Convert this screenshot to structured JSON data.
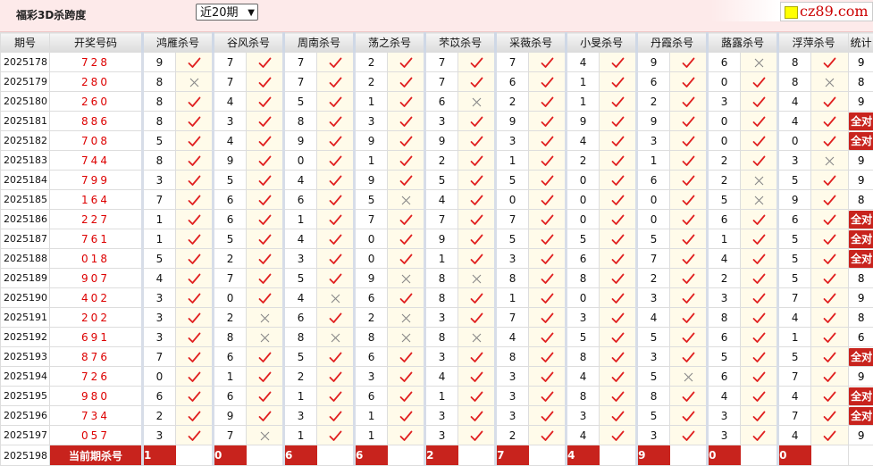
{
  "header": {
    "title": "福彩3D杀跨度",
    "period_select": "近20期",
    "logo_text": "cz89.com"
  },
  "columns": {
    "period": "期号",
    "draw": "开奖号码",
    "experts": [
      "鸿雁杀号",
      "谷风杀号",
      "周南杀号",
      "荡之杀号",
      "芣苡杀号",
      "采薇杀号",
      "小旻杀号",
      "丹霞杀号",
      "蕗露杀号",
      "浮萍杀号"
    ],
    "stat": "统计"
  },
  "colors": {
    "accent": "#c8231d",
    "check": "#e02020",
    "cross": "#888888"
  },
  "rows": [
    {
      "period": "2025178",
      "draw": "728",
      "p": [
        [
          9,
          1
        ],
        [
          7,
          1
        ],
        [
          7,
          1
        ],
        [
          2,
          1
        ],
        [
          7,
          1
        ],
        [
          7,
          1
        ],
        [
          4,
          1
        ],
        [
          9,
          1
        ],
        [
          6,
          0
        ],
        [
          8,
          1
        ]
      ],
      "stat": "9"
    },
    {
      "period": "2025179",
      "draw": "280",
      "p": [
        [
          8,
          0
        ],
        [
          7,
          1
        ],
        [
          7,
          1
        ],
        [
          2,
          1
        ],
        [
          7,
          1
        ],
        [
          6,
          1
        ],
        [
          1,
          1
        ],
        [
          6,
          1
        ],
        [
          0,
          1
        ],
        [
          8,
          0
        ]
      ],
      "stat": "8"
    },
    {
      "period": "2025180",
      "draw": "260",
      "p": [
        [
          8,
          1
        ],
        [
          4,
          1
        ],
        [
          5,
          1
        ],
        [
          1,
          1
        ],
        [
          6,
          0
        ],
        [
          2,
          1
        ],
        [
          1,
          1
        ],
        [
          2,
          1
        ],
        [
          3,
          1
        ],
        [
          4,
          1
        ]
      ],
      "stat": "9"
    },
    {
      "period": "2025181",
      "draw": "886",
      "p": [
        [
          8,
          1
        ],
        [
          3,
          1
        ],
        [
          8,
          1
        ],
        [
          3,
          1
        ],
        [
          3,
          1
        ],
        [
          9,
          1
        ],
        [
          9,
          1
        ],
        [
          9,
          1
        ],
        [
          0,
          1
        ],
        [
          4,
          1
        ]
      ],
      "stat": "全对"
    },
    {
      "period": "2025182",
      "draw": "708",
      "p": [
        [
          5,
          1
        ],
        [
          4,
          1
        ],
        [
          9,
          1
        ],
        [
          9,
          1
        ],
        [
          9,
          1
        ],
        [
          3,
          1
        ],
        [
          4,
          1
        ],
        [
          3,
          1
        ],
        [
          0,
          1
        ],
        [
          0,
          1
        ]
      ],
      "stat": "全对"
    },
    {
      "period": "2025183",
      "draw": "744",
      "p": [
        [
          8,
          1
        ],
        [
          9,
          1
        ],
        [
          0,
          1
        ],
        [
          1,
          1
        ],
        [
          2,
          1
        ],
        [
          1,
          1
        ],
        [
          2,
          1
        ],
        [
          1,
          1
        ],
        [
          2,
          1
        ],
        [
          3,
          0
        ]
      ],
      "stat": "9"
    },
    {
      "period": "2025184",
      "draw": "799",
      "p": [
        [
          3,
          1
        ],
        [
          5,
          1
        ],
        [
          4,
          1
        ],
        [
          9,
          1
        ],
        [
          5,
          1
        ],
        [
          5,
          1
        ],
        [
          0,
          1
        ],
        [
          6,
          1
        ],
        [
          2,
          0
        ],
        [
          5,
          1
        ]
      ],
      "stat": "9"
    },
    {
      "period": "2025185",
      "draw": "164",
      "p": [
        [
          7,
          1
        ],
        [
          6,
          1
        ],
        [
          6,
          1
        ],
        [
          5,
          0
        ],
        [
          4,
          1
        ],
        [
          0,
          1
        ],
        [
          0,
          1
        ],
        [
          0,
          1
        ],
        [
          5,
          0
        ],
        [
          9,
          1
        ]
      ],
      "stat": "8"
    },
    {
      "period": "2025186",
      "draw": "227",
      "p": [
        [
          1,
          1
        ],
        [
          6,
          1
        ],
        [
          1,
          1
        ],
        [
          7,
          1
        ],
        [
          7,
          1
        ],
        [
          7,
          1
        ],
        [
          0,
          1
        ],
        [
          0,
          1
        ],
        [
          6,
          1
        ],
        [
          6,
          1
        ]
      ],
      "stat": "全对"
    },
    {
      "period": "2025187",
      "draw": "761",
      "p": [
        [
          1,
          1
        ],
        [
          5,
          1
        ],
        [
          4,
          1
        ],
        [
          0,
          1
        ],
        [
          9,
          1
        ],
        [
          5,
          1
        ],
        [
          5,
          1
        ],
        [
          5,
          1
        ],
        [
          1,
          1
        ],
        [
          5,
          1
        ]
      ],
      "stat": "全对"
    },
    {
      "period": "2025188",
      "draw": "018",
      "p": [
        [
          5,
          1
        ],
        [
          2,
          1
        ],
        [
          3,
          1
        ],
        [
          0,
          1
        ],
        [
          1,
          1
        ],
        [
          3,
          1
        ],
        [
          6,
          1
        ],
        [
          7,
          1
        ],
        [
          4,
          1
        ],
        [
          5,
          1
        ]
      ],
      "stat": "全对"
    },
    {
      "period": "2025189",
      "draw": "907",
      "p": [
        [
          4,
          1
        ],
        [
          7,
          1
        ],
        [
          5,
          1
        ],
        [
          9,
          0
        ],
        [
          8,
          0
        ],
        [
          8,
          1
        ],
        [
          8,
          1
        ],
        [
          2,
          1
        ],
        [
          2,
          1
        ],
        [
          5,
          1
        ]
      ],
      "stat": "8"
    },
    {
      "period": "2025190",
      "draw": "402",
      "p": [
        [
          3,
          1
        ],
        [
          0,
          1
        ],
        [
          4,
          0
        ],
        [
          6,
          1
        ],
        [
          8,
          1
        ],
        [
          1,
          1
        ],
        [
          0,
          1
        ],
        [
          3,
          1
        ],
        [
          3,
          1
        ],
        [
          7,
          1
        ]
      ],
      "stat": "9"
    },
    {
      "period": "2025191",
      "draw": "202",
      "p": [
        [
          3,
          1
        ],
        [
          2,
          0
        ],
        [
          6,
          1
        ],
        [
          2,
          0
        ],
        [
          3,
          1
        ],
        [
          7,
          1
        ],
        [
          3,
          1
        ],
        [
          4,
          1
        ],
        [
          8,
          1
        ],
        [
          4,
          1
        ]
      ],
      "stat": "8"
    },
    {
      "period": "2025192",
      "draw": "691",
      "p": [
        [
          3,
          1
        ],
        [
          8,
          0
        ],
        [
          8,
          0
        ],
        [
          8,
          0
        ],
        [
          8,
          0
        ],
        [
          4,
          1
        ],
        [
          5,
          1
        ],
        [
          5,
          1
        ],
        [
          6,
          1
        ],
        [
          1,
          1
        ]
      ],
      "stat": "6"
    },
    {
      "period": "2025193",
      "draw": "876",
      "p": [
        [
          7,
          1
        ],
        [
          6,
          1
        ],
        [
          5,
          1
        ],
        [
          6,
          1
        ],
        [
          3,
          1
        ],
        [
          8,
          1
        ],
        [
          8,
          1
        ],
        [
          3,
          1
        ],
        [
          5,
          1
        ],
        [
          5,
          1
        ]
      ],
      "stat": "全对"
    },
    {
      "period": "2025194",
      "draw": "726",
      "p": [
        [
          0,
          1
        ],
        [
          1,
          1
        ],
        [
          2,
          1
        ],
        [
          3,
          1
        ],
        [
          4,
          1
        ],
        [
          3,
          1
        ],
        [
          4,
          1
        ],
        [
          5,
          0
        ],
        [
          6,
          1
        ],
        [
          7,
          1
        ]
      ],
      "stat": "9"
    },
    {
      "period": "2025195",
      "draw": "980",
      "p": [
        [
          6,
          1
        ],
        [
          6,
          1
        ],
        [
          1,
          1
        ],
        [
          6,
          1
        ],
        [
          1,
          1
        ],
        [
          3,
          1
        ],
        [
          8,
          1
        ],
        [
          8,
          1
        ],
        [
          4,
          1
        ],
        [
          4,
          1
        ]
      ],
      "stat": "全对"
    },
    {
      "period": "2025196",
      "draw": "734",
      "p": [
        [
          2,
          1
        ],
        [
          9,
          1
        ],
        [
          3,
          1
        ],
        [
          1,
          1
        ],
        [
          3,
          1
        ],
        [
          3,
          1
        ],
        [
          3,
          1
        ],
        [
          5,
          1
        ],
        [
          3,
          1
        ],
        [
          7,
          1
        ]
      ],
      "stat": "全对"
    },
    {
      "period": "2025197",
      "draw": "057",
      "p": [
        [
          3,
          1
        ],
        [
          7,
          0
        ],
        [
          1,
          1
        ],
        [
          1,
          1
        ],
        [
          3,
          1
        ],
        [
          2,
          1
        ],
        [
          4,
          1
        ],
        [
          3,
          1
        ],
        [
          3,
          1
        ],
        [
          4,
          1
        ]
      ],
      "stat": "9"
    }
  ],
  "current": {
    "period": "2025198",
    "label": "当前期杀号",
    "values": [
      "1",
      "0",
      "6",
      "6",
      "2",
      "7",
      "4",
      "9",
      "0",
      "0"
    ]
  }
}
